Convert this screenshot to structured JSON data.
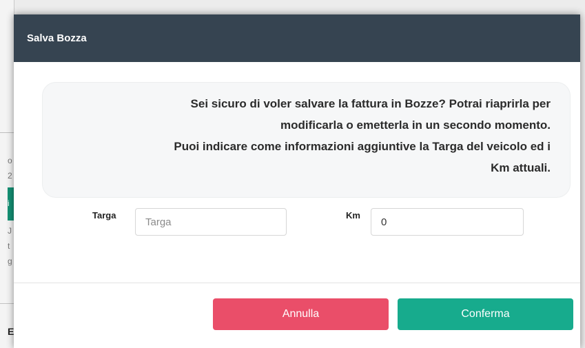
{
  "background": {
    "edge_fragments": [
      "o",
      "2",
      "i",
      "J",
      "t",
      "g",
      "E"
    ]
  },
  "modal": {
    "title": "Salva Bozza",
    "message_lines": [
      "Sei sicuro di voler salvare la fattura in Bozze? Potrai riaprirla per",
      "modificarla o emetterla in un secondo momento.",
      "Puoi indicare come informazioni aggiuntive la Targa del veicolo ed i",
      "Km attuali."
    ],
    "fields": {
      "targa": {
        "label": "Targa",
        "value": "",
        "placeholder": "Targa"
      },
      "km": {
        "label": "Km",
        "value": "0",
        "placeholder": ""
      }
    },
    "buttons": {
      "cancel_label": "Annulla",
      "confirm_label": "Conferma"
    }
  },
  "colors": {
    "header": "#364451",
    "cancel": "#ea4e69",
    "confirm": "#17ab8d"
  }
}
